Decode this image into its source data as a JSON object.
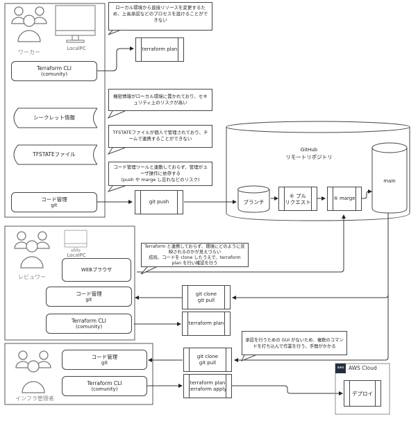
{
  "worker": {
    "role_label": "ワーカー",
    "pc_label": "LocalPC",
    "terraform_cli": {
      "title": "Terraform CLI",
      "sub": "(comunity)"
    },
    "secret_label": "シークレット情報",
    "tfstate_label": "TFSTATEファイル",
    "code_mgmt": {
      "title": "コード管理",
      "sub": "git"
    }
  },
  "callouts": {
    "local_change": "ローカル環境から直接リソースを変更するため、上長承認などのプロセスを設けることができない",
    "secret_risk": "機密情報がローカル環境に置かれており、セキュリティ上のリスクが高い",
    "tfstate_risk": "TFSTATEファイルが個人で管理されており、チームで連携することができない",
    "code_mgmt_risk_1": "コード管理ツールと連動しておらず、管理がユーザ操作に依存する",
    "code_mgmt_risk_2": "(push や marge し忘れなどのリスク)",
    "reviewer_risk_1": "Terraform と連携しておらず、環境にどのように反映されるのかが見えづらい",
    "reviewer_risk_2": "結局、コードを clone したうえで、terraform plan を行い確認を行う",
    "infra_risk": "承認を行うための GUI がないため、複数のコマンドを打ち込んで作業を行う、手間がかかる"
  },
  "processes": {
    "worker_plan": "terraform plan",
    "git_push": "git push",
    "reviewer_clone": {
      "line1": "git clone",
      "line2": "git pull"
    },
    "reviewer_plan": "terraform plan",
    "infra_clone": {
      "line1": "git clone",
      "line2": "git pull"
    },
    "infra_apply": {
      "line1": "terraform plan",
      "line2": "terraform apply"
    }
  },
  "github": {
    "title": "GitHub",
    "subtitle": "リモートリポジトリ",
    "branch": "ブランチ",
    "pull_request": {
      "line1": "④ プル",
      "line2": "リクエスト"
    },
    "merge": "⑤ marge",
    "main": "main"
  },
  "reviewer": {
    "role_label": "レビュワー",
    "pc_label": "LocalPC",
    "browser": "WEBブラウザ",
    "code_mgmt": {
      "title": "コード管理",
      "sub": "git"
    },
    "terraform_cli": {
      "title": "Terraform CLI",
      "sub": "(comunity)"
    }
  },
  "infra": {
    "role_label": "インフラ管理者",
    "code_mgmt": {
      "title": "コード管理",
      "sub": "git"
    },
    "terraform_cli": {
      "title": "Terraform CLI",
      "sub": "(comunity)"
    }
  },
  "aws": {
    "title": "AWS Cloud",
    "logo": "aws",
    "deploy": "デプロイ",
    "accent": "#232f3e"
  }
}
